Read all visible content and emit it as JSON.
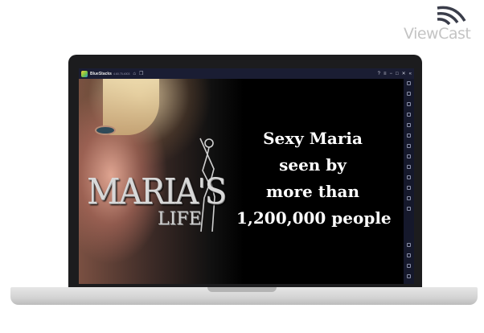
{
  "watermark": {
    "text": "ViewCast"
  },
  "emulator": {
    "app_name": "BlueStacks",
    "version": "4.60.75.4003",
    "titlebar_icons": [
      "home-icon",
      "multi-instance-icon"
    ],
    "window_controls": [
      "help-icon",
      "menu-icon",
      "minimize-icon",
      "maximize-icon",
      "close-icon",
      "collapse-icon"
    ],
    "sidebar_icons": [
      "fullscreen-icon",
      "volume-up-icon",
      "volume-down-icon",
      "keymap-icon",
      "shake-icon",
      "rotate-icon",
      "camera-icon",
      "record-icon",
      "screenshot-icon",
      "media-folder-icon",
      "copy-icon",
      "multi-instance-sync-icon",
      "eco-mode-icon",
      "settings-icon",
      "back-icon",
      "home-icon",
      "recent-apps-icon"
    ]
  },
  "game": {
    "logo_main": "MARIA'S",
    "logo_sub": "LIFE",
    "caption_lines": [
      "Sexy Maria",
      "seen by",
      "more than",
      "1,200,000 people"
    ]
  }
}
